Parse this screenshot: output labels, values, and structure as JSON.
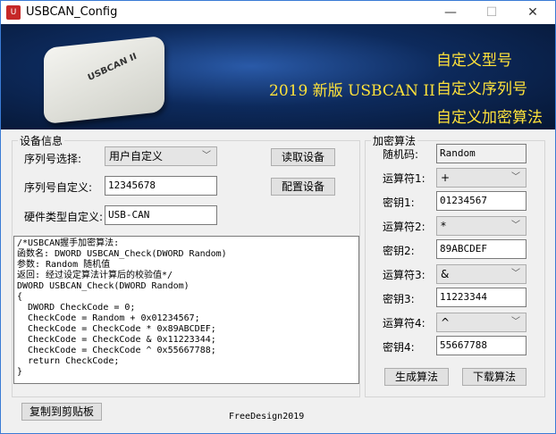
{
  "window": {
    "title": "USBCAN_Config",
    "minimize": "—",
    "maximize": "☐",
    "close": "✕"
  },
  "banner": {
    "headline": "2019 新版 USBCAN II",
    "features": [
      "自定义型号",
      "自定义序列号",
      "自定义加密算法"
    ],
    "device_label": "USBCAN II"
  },
  "device_info": {
    "group_label": "设备信息",
    "serial_select_label": "序列号选择:",
    "serial_select_value": "用户自定义",
    "serial_custom_label": "序列号自定义:",
    "serial_custom_value": "12345678",
    "hw_type_label": "硬件类型自定义:",
    "hw_type_value": "USB-CAN",
    "read_button": "读取设备",
    "config_button": "配置设备"
  },
  "code_text": "/*USBCAN握手加密算法:\n函数名: DWORD USBCAN_Check(DWORD Random)\n参数: Random 随机值\n返回: 经过设定算法计算后的校验值*/\nDWORD USBCAN_Check(DWORD Random)\n{\n  DWORD CheckCode = 0;\n  CheckCode = Random + 0x01234567;\n  CheckCode = CheckCode * 0x89ABCDEF;\n  CheckCode = CheckCode & 0x11223344;\n  CheckCode = CheckCode ^ 0x55667788;\n  return CheckCode;\n}",
  "encryption": {
    "group_label": "加密算法",
    "random_label": "随机码:",
    "random_value": "Random",
    "steps": [
      {
        "op_label": "运算符1:",
        "op": "+",
        "key_label": "密钥1:",
        "key": "01234567"
      },
      {
        "op_label": "运算符2:",
        "op": "*",
        "key_label": "密钥2:",
        "key": "89ABCDEF"
      },
      {
        "op_label": "运算符3:",
        "op": "&",
        "key_label": "密钥3:",
        "key": "11223344"
      },
      {
        "op_label": "运算符4:",
        "op": "^",
        "key_label": "密钥4:",
        "key": "55667788"
      }
    ],
    "generate_button": "生成算法",
    "download_button": "下载算法"
  },
  "copy_button": "复制到剪贴板",
  "footer": "FreeDesign2019"
}
